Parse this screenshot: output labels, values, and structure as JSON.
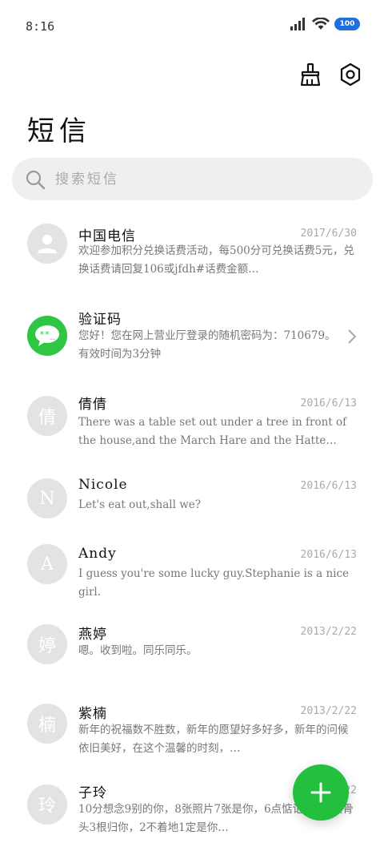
{
  "status": {
    "time": "8:16",
    "battery": "100"
  },
  "header": {
    "title": "短信",
    "clean_icon": "broom-icon",
    "settings_icon": "gear-icon"
  },
  "search": {
    "placeholder": "搜索短信"
  },
  "messages": [
    {
      "sender": "中国电信",
      "date": "2017/6/30",
      "preview": "欢迎参加积分兑换话费活动，每500分可兑换话费5元，兑换话费请回复106或jfdh#话费金额…",
      "avatar": "",
      "avatar_type": "person"
    },
    {
      "sender": "验证码",
      "date": "",
      "preview": "您好！您在网上营业厅登录的随机密码为：710679。有效时间为3分钟",
      "avatar": "**_",
      "avatar_type": "green"
    },
    {
      "sender": "倩倩",
      "date": "2016/6/13",
      "preview": "There was a table set out under a tree in front of the house,and the March Hare and the Hatte…",
      "avatar": "倩",
      "avatar_type": "letter"
    },
    {
      "sender": "Nicole",
      "date": "2016/6/13",
      "preview": "Let's eat out,shall we?",
      "avatar": "N",
      "avatar_type": "letter"
    },
    {
      "sender": "Andy",
      "date": "2016/6/13",
      "preview": "I guess you're some lucky guy.Stephanie is a nice girl.",
      "avatar": "A",
      "avatar_type": "letter"
    },
    {
      "sender": "燕婷",
      "date": "2013/2/22",
      "preview": "嗯。收到啦。同乐同乐。",
      "avatar": "婷",
      "avatar_type": "letter"
    },
    {
      "sender": "紫楠",
      "date": "2013/2/22",
      "preview": "新年的祝福数不胜数，新年的愿望好多好多，新年的问候依旧美好，在这个温馨的时刻，…",
      "avatar": "楠",
      "avatar_type": "letter"
    },
    {
      "sender": "子玲",
      "date": "2013/2/22",
      "preview": "10分想念9别的你，8张照片7张是你，6点惦记你，4根骨头3根归你，2不着地1定是你…",
      "avatar": "玲",
      "avatar_type": "letter"
    }
  ],
  "fab": {
    "label": "+"
  }
}
